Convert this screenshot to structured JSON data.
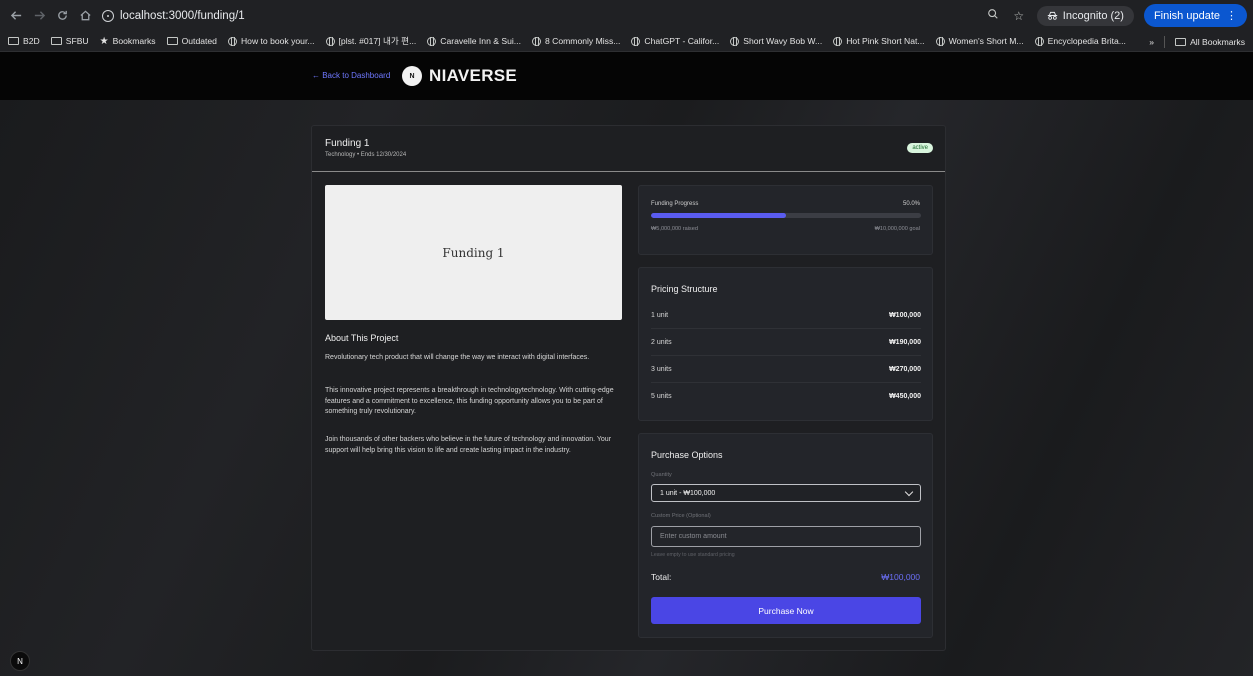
{
  "browser": {
    "url": "localhost:3000/funding/1",
    "incognito_label": "Incognito (2)",
    "finish_update_label": "Finish update",
    "bookmarks": [
      {
        "label": "B2D",
        "icon": "folder-icon"
      },
      {
        "label": "SFBU",
        "icon": "folder-icon"
      },
      {
        "label": "Bookmarks",
        "icon": "star-icon"
      },
      {
        "label": "Outdated",
        "icon": "folder-icon"
      },
      {
        "label": "How to book your...",
        "icon": "globe-icon"
      },
      {
        "label": "[plst. #017] 내가 편...",
        "icon": "globe-icon"
      },
      {
        "label": "Caravelle Inn & Sui...",
        "icon": "globe-icon"
      },
      {
        "label": "8 Commonly Miss...",
        "icon": "globe-icon"
      },
      {
        "label": "ChatGPT - Califor...",
        "icon": "globe-icon"
      },
      {
        "label": "Short Wavy Bob W...",
        "icon": "globe-icon"
      },
      {
        "label": "Hot Pink Short Nat...",
        "icon": "globe-icon"
      },
      {
        "label": "Women's Short M...",
        "icon": "globe-icon"
      },
      {
        "label": "Encyclopedia Brita...",
        "icon": "globe-icon"
      }
    ],
    "overflow_label": "»",
    "all_bookmarks_label": "All Bookmarks"
  },
  "header": {
    "back_label": "← Back to Dashboard",
    "logo_mark": "N",
    "brand": "NIAVERSE"
  },
  "project": {
    "title": "Funding 1",
    "subtitle": "Technology • Ends 12/30/2024",
    "status": "active",
    "image_label": "Funding 1",
    "about_title": "About This Project",
    "paragraphs": [
      "Revolutionary tech product that will change the way we interact with digital interfaces.",
      "This innovative project represents a breakthrough in technologytechnology. With cutting-edge features and a commitment to excellence, this funding opportunity allows you to be part of something truly revolutionary.",
      "Join thousands of other backers who believe in the future of technology and innovation. Your support will help bring this vision to life and create lasting impact in the industry."
    ]
  },
  "progress": {
    "label": "Funding Progress",
    "percent_text": "50.0%",
    "fraction": 0.5,
    "raised": "₩5,000,000 raised",
    "goal": "₩10,000,000 goal"
  },
  "pricing": {
    "title": "Pricing Structure",
    "rows": [
      {
        "units": "1 unit",
        "price": "₩100,000"
      },
      {
        "units": "2 units",
        "price": "₩190,000"
      },
      {
        "units": "3 units",
        "price": "₩270,000"
      },
      {
        "units": "5 units",
        "price": "₩450,000"
      }
    ]
  },
  "purchase": {
    "title": "Purchase Options",
    "quantity_label": "Quantity",
    "quantity_value": "1 unit - ₩100,000",
    "custom_label": "Custom Price (Optional)",
    "custom_placeholder": "Enter custom amount",
    "hint": "Leave empty to use standard pricing",
    "total_label": "Total:",
    "total_value": "₩100,000",
    "button_label": "Purchase Now"
  },
  "dev_badge": "N",
  "colors": {
    "accent": "#4a46e5",
    "progress_fill": "#5a5cf0",
    "link": "#6f78ff",
    "status_bg": "#d9f5de"
  }
}
